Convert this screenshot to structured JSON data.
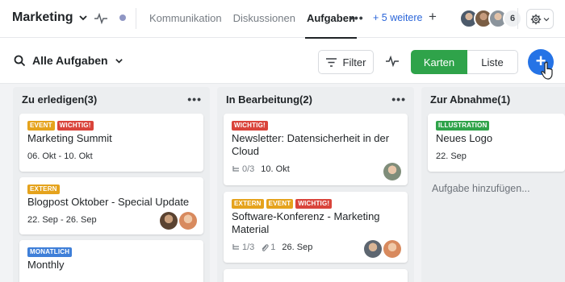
{
  "header": {
    "project_name": "Marketing",
    "tabs": [
      "Kommunikation",
      "Diskussionen",
      "Aufgaben"
    ],
    "active_tab": "Aufgaben",
    "more_link": "+ 5 weitere",
    "add_tab": "+",
    "member_count": "6"
  },
  "toolbar": {
    "view_title": "Alle Aufgaben",
    "filter_label": "Filter",
    "view_modes": [
      "Karten",
      "Liste"
    ],
    "active_view": "Karten",
    "add_button": "+"
  },
  "colors": {
    "accent_green": "#2fa34a",
    "accent_blue": "#2573e6",
    "tag_event": "#e5a31d",
    "tag_wichtig": "#d9443b",
    "tag_monatlich": "#3f7fd8",
    "tag_illustration": "#2fa34a"
  },
  "columns": [
    {
      "title": "Zu erledigen(3)",
      "cards": [
        {
          "tags": [
            "EVENT",
            "WICHTIG!"
          ],
          "title": "Marketing Summit",
          "date": "06. Okt - 10. Okt"
        },
        {
          "tags": [
            "EXTERN"
          ],
          "title": "Blogpost Oktober - Special Update",
          "date": "22. Sep - 26. Sep"
        },
        {
          "tags": [
            "MONATLICH"
          ],
          "title": "Monthly"
        }
      ]
    },
    {
      "title": "In Bearbeitung(2)",
      "cards": [
        {
          "tags": [
            "WICHTIG!"
          ],
          "title": "Newsletter: Datensicherheit in der Cloud",
          "subtasks": "0/3",
          "date": "10. Okt"
        },
        {
          "tags": [
            "EXTERN",
            "EVENT",
            "WICHTIG!"
          ],
          "title": "Software-Konferenz - Marketing Material",
          "subtasks": "1/3",
          "attachments": "1",
          "date": "26. Sep"
        }
      ]
    },
    {
      "title": "Zur Abnahme(1)",
      "cards": [
        {
          "tags": [
            "ILLUSTRATION"
          ],
          "title": "Neues Logo",
          "date": "22. Sep"
        }
      ],
      "add_task": "Aufgabe hinzufügen..."
    }
  ]
}
